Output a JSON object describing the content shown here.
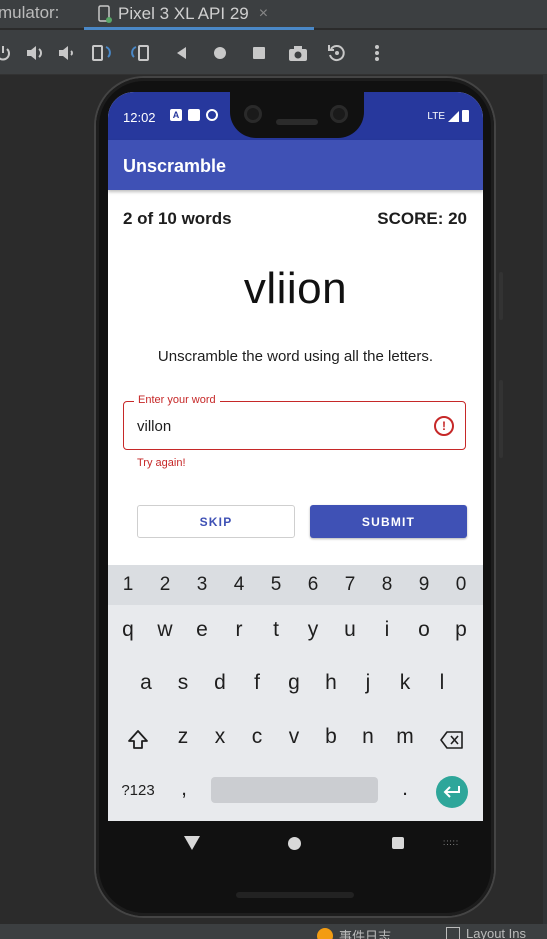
{
  "ide": {
    "title_fragment": "mulator:",
    "tab_label": "Pixel 3 XL API 29",
    "tab_close": "×",
    "toolbar_icons": [
      "power-icon",
      "volume-up-icon",
      "volume-down-icon",
      "rotate-left-icon",
      "rotate-right-icon",
      "back-icon",
      "home-icon",
      "overview-icon",
      "screenshot-icon",
      "replay-icon",
      "more-icon"
    ],
    "status_items": [
      "事件日志",
      "Layout Ins"
    ]
  },
  "device": {
    "status_time": "12:02",
    "status_network": "LTE",
    "app_title": "Unscramble",
    "word_count": "2 of 10 words",
    "score": "SCORE: 20",
    "scrambled_word": "vliion",
    "instructions": "Unscramble the word using all the letters.",
    "input": {
      "label": "Enter your word",
      "value": "villon",
      "error": "Try again!"
    },
    "buttons": {
      "skip": "SKIP",
      "submit": "SUBMIT"
    }
  },
  "keyboard": {
    "numbers": [
      "1",
      "2",
      "3",
      "4",
      "5",
      "6",
      "7",
      "8",
      "9",
      "0"
    ],
    "row1": [
      "q",
      "w",
      "e",
      "r",
      "t",
      "y",
      "u",
      "i",
      "o",
      "p"
    ],
    "row2": [
      "a",
      "s",
      "d",
      "f",
      "g",
      "h",
      "j",
      "k",
      "l"
    ],
    "row3": [
      "z",
      "x",
      "c",
      "v",
      "b",
      "n",
      "m"
    ],
    "symbols_key": "?123",
    "comma_key": ",",
    "period_key": "."
  },
  "colors": {
    "primary": "#3f51b5",
    "primary_dark": "#27389d",
    "error": "#c62828",
    "enter": "#2ea69a"
  }
}
